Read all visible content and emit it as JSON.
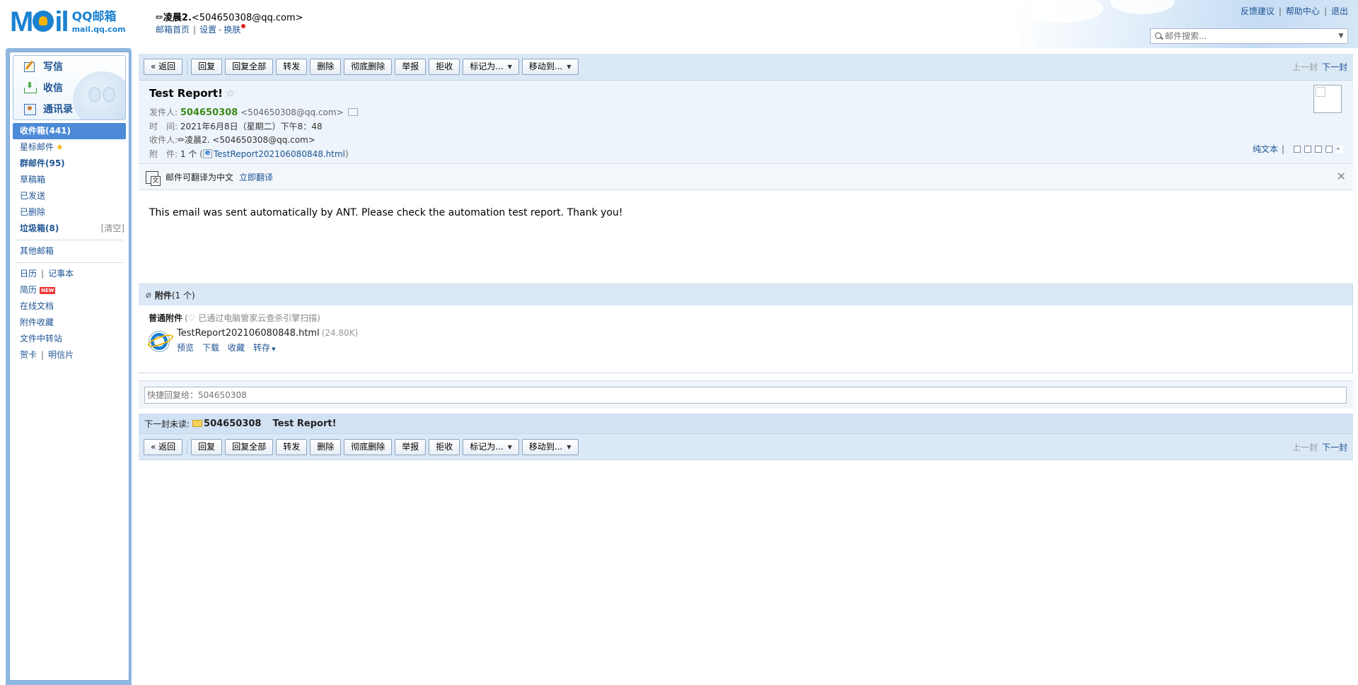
{
  "header": {
    "logo_big": "M",
    "logo_big_tail": "il",
    "logo_cn": "QQ邮箱",
    "logo_en": "mail.qq.com",
    "user_prefix": "✏",
    "user_nick": "凌晨2.",
    "user_email": "<504650308@qq.com>",
    "links": [
      "邮箱首页",
      "设置",
      "换肤"
    ],
    "top_links": [
      "反馈建议",
      "帮助中心",
      "退出"
    ],
    "search_placeholder": "邮件搜索..."
  },
  "sidebar": {
    "quick": [
      {
        "label": "写信",
        "icon": "write-icon"
      },
      {
        "label": "收信",
        "icon": "inbox-download-icon"
      },
      {
        "label": "通讯录",
        "icon": "contacts-icon"
      }
    ],
    "folders": {
      "inbox": "收件箱(441)",
      "starred": "星标邮件",
      "groups": "群邮件(95)",
      "drafts": "草稿箱",
      "sent": "已发送",
      "deleted": "已删除",
      "spam": "垃圾箱(8)",
      "spam_clear": "[清空]",
      "other": "其他邮箱",
      "calendar": "日历",
      "notes": "记事本",
      "resume": "简历",
      "resume_badge": "NEW",
      "docs": "在线文档",
      "attach_fav": "附件收藏",
      "transfer": "文件中转站",
      "cards": "贺卡",
      "postcard": "明信片"
    }
  },
  "toolbar": {
    "back": "« 返回",
    "reply": "回复",
    "reply_all": "回复全部",
    "forward": "转发",
    "delete": "删除",
    "perm_delete": "彻底删除",
    "report": "举报",
    "reject": "拒收",
    "mark_as": "标记为...",
    "move_to": "移动到...",
    "prev": "上一封",
    "next": "下一封"
  },
  "mail": {
    "subject": "Test Report!",
    "from_key": "发件人:",
    "from_name": "504650308",
    "from_email": "<504650308@qq.com>",
    "time_key": "时　间:",
    "time_val": "2021年6月8日（星期二）下午8：48",
    "to_key": "收件人:",
    "to_val": "✏凌晨2. <504650308@qq.com>",
    "att_key": "附　件:",
    "att_count": "1 个",
    "att_name": "TestReport202106080848.html",
    "plain_text": "纯文本",
    "translate_text": "邮件可翻译为中文",
    "translate_link": "立即翻译",
    "body": "This email was sent automatically by ANT. Please check the automation test report. Thank you!"
  },
  "attachment": {
    "title": "附件",
    "count": "(1 个)",
    "category": "普通附件",
    "scan_note": "(♡ 已通过电脑管家云查杀引擎扫描)",
    "file_name": "TestReport202106080848.html",
    "file_size": "(24.80K)",
    "actions": [
      "预览",
      "下载",
      "收藏",
      "转存"
    ]
  },
  "quick_reply": {
    "placeholder": "快捷回复给：504650308"
  },
  "next_unread": {
    "label": "下一封未读:",
    "sender": "504650308",
    "subject": "Test Report!"
  },
  "colors": {
    "accent": "#4d8ad7",
    "sender_green": "#3b8a18",
    "link": "#1e5494"
  }
}
